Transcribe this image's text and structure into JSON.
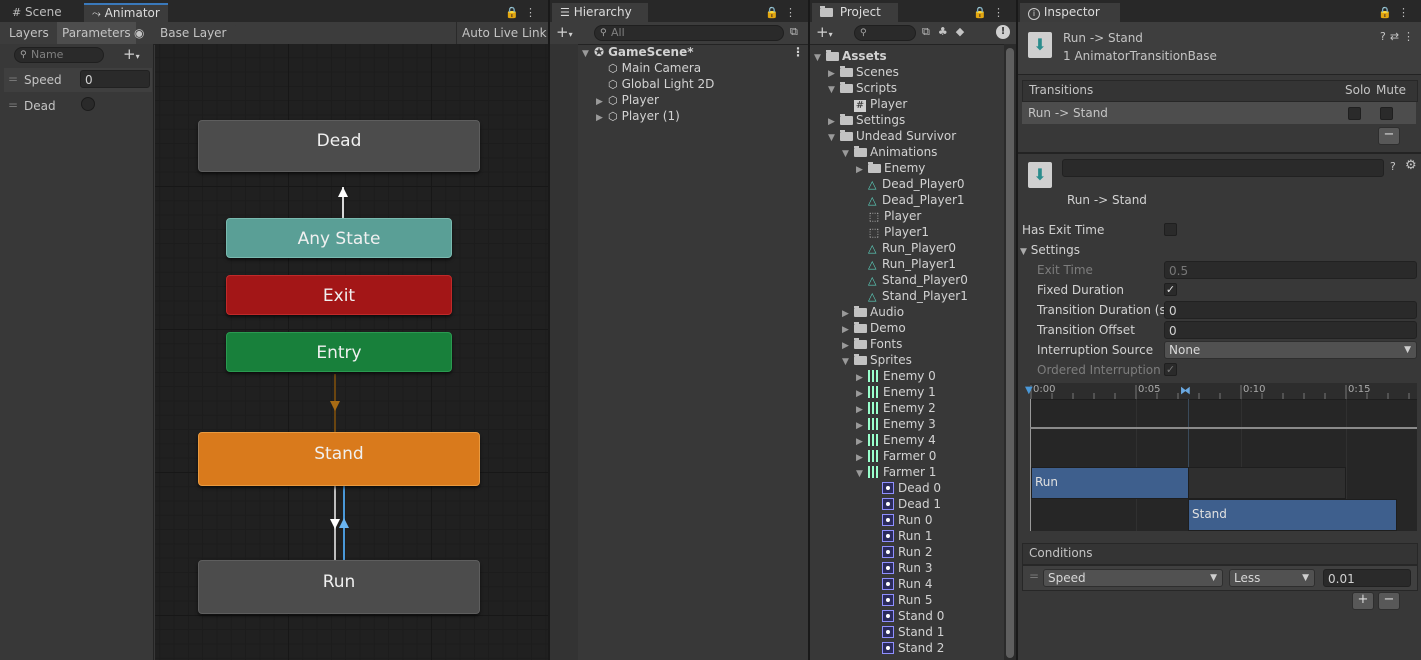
{
  "animator": {
    "tabs": {
      "scene": "Scene",
      "animator": "Animator"
    },
    "toolbar": {
      "layers": "Layers",
      "parameters": "Parameters",
      "base_layer": "Base Layer",
      "auto_live_link": "Auto Live Link"
    },
    "search_placeholder": "Name",
    "parameters": [
      {
        "name": "Speed",
        "type": "float",
        "value": "0"
      },
      {
        "name": "Dead",
        "type": "trigger",
        "value": ""
      }
    ],
    "states": {
      "dead": "Dead",
      "any_state": "Any State",
      "exit": "Exit",
      "entry": "Entry",
      "stand": "Stand",
      "run": "Run"
    },
    "colors": {
      "any_state": "#5a9f96",
      "exit": "#a31617",
      "entry": "#18803b",
      "stand": "#d97a1c",
      "default": "#4c4c4c",
      "selected_transition": "#4a98d8"
    }
  },
  "hierarchy": {
    "tab": "Hierarchy",
    "search_placeholder": "All",
    "scene": "GameScene*",
    "items": [
      "Main Camera",
      "Global Light 2D",
      "Player",
      "Player (1)"
    ]
  },
  "project": {
    "tab": "Project",
    "tree": [
      {
        "label": "Assets",
        "depth": 0,
        "kind": "folder",
        "open": true
      },
      {
        "label": "Scenes",
        "depth": 1,
        "kind": "folder",
        "open": false
      },
      {
        "label": "Scripts",
        "depth": 1,
        "kind": "folder",
        "open": true
      },
      {
        "label": "Player",
        "depth": 2,
        "kind": "script"
      },
      {
        "label": "Settings",
        "depth": 1,
        "kind": "folder",
        "open": false
      },
      {
        "label": "Undead Survivor",
        "depth": 1,
        "kind": "folder",
        "open": true
      },
      {
        "label": "Animations",
        "depth": 2,
        "kind": "folder",
        "open": true
      },
      {
        "label": "Enemy",
        "depth": 3,
        "kind": "folder",
        "open": false
      },
      {
        "label": "Dead_Player0",
        "depth": 3,
        "kind": "anim"
      },
      {
        "label": "Dead_Player1",
        "depth": 3,
        "kind": "anim"
      },
      {
        "label": "Player",
        "depth": 3,
        "kind": "controller"
      },
      {
        "label": "Player1",
        "depth": 3,
        "kind": "controller"
      },
      {
        "label": "Run_Player0",
        "depth": 3,
        "kind": "anim"
      },
      {
        "label": "Run_Player1",
        "depth": 3,
        "kind": "anim"
      },
      {
        "label": "Stand_Player0",
        "depth": 3,
        "kind": "anim"
      },
      {
        "label": "Stand_Player1",
        "depth": 3,
        "kind": "anim"
      },
      {
        "label": "Audio",
        "depth": 2,
        "kind": "folder",
        "open": false
      },
      {
        "label": "Demo",
        "depth": 2,
        "kind": "folder",
        "open": false
      },
      {
        "label": "Fonts",
        "depth": 2,
        "kind": "folder",
        "open": false
      },
      {
        "label": "Sprites",
        "depth": 2,
        "kind": "folder",
        "open": true
      },
      {
        "label": "Enemy 0",
        "depth": 3,
        "kind": "sheet",
        "open": false
      },
      {
        "label": "Enemy 1",
        "depth": 3,
        "kind": "sheet",
        "open": false
      },
      {
        "label": "Enemy 2",
        "depth": 3,
        "kind": "sheet",
        "open": false
      },
      {
        "label": "Enemy 3",
        "depth": 3,
        "kind": "sheet",
        "open": false
      },
      {
        "label": "Enemy 4",
        "depth": 3,
        "kind": "sheet",
        "open": false
      },
      {
        "label": "Farmer 0",
        "depth": 3,
        "kind": "sheet",
        "open": false
      },
      {
        "label": "Farmer 1",
        "depth": 3,
        "kind": "sheet",
        "open": true
      },
      {
        "label": "Dead 0",
        "depth": 4,
        "kind": "sprite"
      },
      {
        "label": "Dead 1",
        "depth": 4,
        "kind": "sprite"
      },
      {
        "label": "Run 0",
        "depth": 4,
        "kind": "sprite"
      },
      {
        "label": "Run 1",
        "depth": 4,
        "kind": "sprite"
      },
      {
        "label": "Run 2",
        "depth": 4,
        "kind": "sprite"
      },
      {
        "label": "Run 3",
        "depth": 4,
        "kind": "sprite"
      },
      {
        "label": "Run 4",
        "depth": 4,
        "kind": "sprite"
      },
      {
        "label": "Run 5",
        "depth": 4,
        "kind": "sprite"
      },
      {
        "label": "Stand 0",
        "depth": 4,
        "kind": "sprite"
      },
      {
        "label": "Stand 1",
        "depth": 4,
        "kind": "sprite"
      },
      {
        "label": "Stand 2",
        "depth": 4,
        "kind": "sprite"
      }
    ]
  },
  "inspector": {
    "tab": "Inspector",
    "header_title": "Run -> Stand",
    "header_subtitle": "1 AnimatorTransitionBase",
    "transitions_label": "Transitions",
    "solo_label": "Solo",
    "mute_label": "Mute",
    "transition_row": "Run -> Stand",
    "minus": "−",
    "plus": "+",
    "transition_name_value": "",
    "sub_title": "Run -> Stand",
    "has_exit_time_label": "Has Exit Time",
    "settings_label": "Settings",
    "exit_time_label": "Exit Time",
    "exit_time_value": "0.5",
    "fixed_duration_label": "Fixed Duration",
    "transition_duration_label": "Transition Duration (s)",
    "transition_duration_value": "0",
    "transition_offset_label": "Transition Offset",
    "transition_offset_value": "0",
    "interruption_source_label": "Interruption Source",
    "interruption_source_value": "None",
    "ordered_interruption_label": "Ordered Interruption",
    "timeline_ticks": [
      "0:00",
      "0:05",
      "0:10",
      "0:15"
    ],
    "timeline_run": "Run",
    "timeline_stand": "Stand",
    "conditions_label": "Conditions",
    "condition_param": "Speed",
    "condition_op": "Less",
    "condition_value": "0.01"
  }
}
